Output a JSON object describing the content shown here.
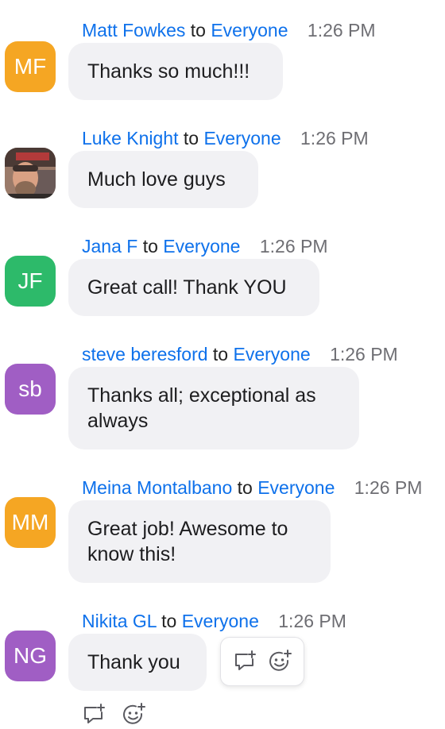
{
  "messages": [
    {
      "initials": "MF",
      "avatar_color": "#f5a623",
      "sender": "Matt Fowkes",
      "to": "to",
      "recipient": "Everyone",
      "time": "1:26 PM",
      "text": "Thanks so much!!!"
    },
    {
      "initials": "",
      "avatar_color": "#8a5a45",
      "sender": "Luke Knight",
      "to": "to",
      "recipient": "Everyone",
      "time": "1:26 PM",
      "text": "Much love guys"
    },
    {
      "initials": "JF",
      "avatar_color": "#2dba6a",
      "sender": "Jana F",
      "to": "to",
      "recipient": "Everyone",
      "time": "1:26 PM",
      "text": "Great call! Thank YOU"
    },
    {
      "initials": "sb",
      "avatar_color": "#a05ec4",
      "sender": "steve beresford",
      "to": "to",
      "recipient": "Everyone",
      "time": "1:26 PM",
      "text": "Thanks all; exceptional as always"
    },
    {
      "initials": "MM",
      "avatar_color": "#f5a623",
      "sender": "Meina Montalbano",
      "to": "to",
      "recipient": "Everyone",
      "time": "1:26 PM",
      "text": "Great job! Awesome to know this!"
    },
    {
      "initials": "NG",
      "avatar_color": "#a05ec4",
      "sender": "Nikita GL",
      "to": "to",
      "recipient": "Everyone",
      "time": "1:26 PM",
      "text": "Thank you"
    }
  ],
  "icons": {
    "reply": "reply-thread-icon",
    "reaction": "add-reaction-icon"
  },
  "colors": {
    "link_blue": "#0e71eb",
    "bubble_bg": "#f1f1f4",
    "time_gray": "#6e6e73"
  }
}
